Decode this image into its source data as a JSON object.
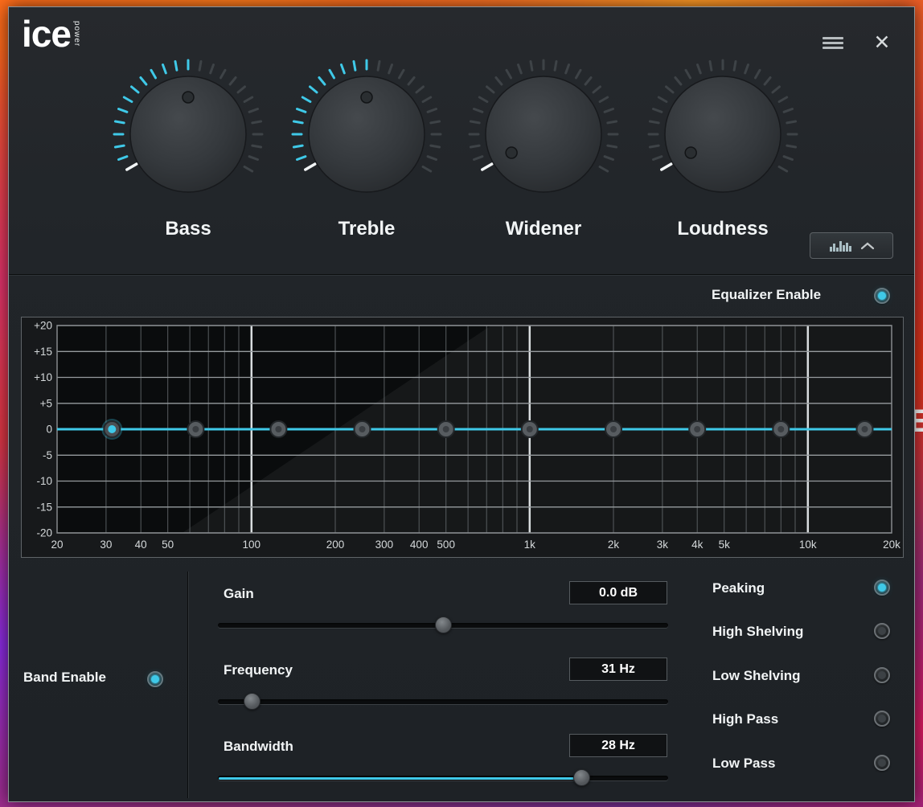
{
  "colors": {
    "accent": "#3fc9e8",
    "label_text": "#f1f4f5"
  },
  "desktop": {
    "fragment_text": "E"
  },
  "window": {
    "logo_main": "ice",
    "logo_sub": "power",
    "close_glyph": "✕"
  },
  "knobs": [
    {
      "label": "Bass",
      "value_fraction": 0.5,
      "lit": true
    },
    {
      "label": "Treble",
      "value_fraction": 0.5,
      "lit": true
    },
    {
      "label": "Widener",
      "value_fraction": 0,
      "lit": false
    },
    {
      "label": "Loudness",
      "value_fraction": 0,
      "lit": false
    }
  ],
  "equalizer": {
    "enable_label": "Equalizer Enable",
    "enabled": true
  },
  "band_controls": {
    "enable_label": "Band Enable",
    "enabled": true,
    "sliders": [
      {
        "label": "Gain",
        "value": "0.0 dB",
        "fraction": 0.5,
        "filled": false
      },
      {
        "label": "Frequency",
        "value": "31 Hz",
        "fraction": 0.06,
        "filled": false
      },
      {
        "label": "Bandwidth",
        "value": "28 Hz",
        "fraction": 0.82,
        "filled": true
      }
    ],
    "filter_types": [
      {
        "label": "Peaking",
        "selected": true
      },
      {
        "label": "High Shelving",
        "selected": false
      },
      {
        "label": "Low Shelving",
        "selected": false
      },
      {
        "label": "High Pass",
        "selected": false
      },
      {
        "label": "Low Pass",
        "selected": false
      }
    ]
  },
  "chart_data": {
    "type": "line",
    "x_scale": "log",
    "x_range_hz": [
      20,
      20000
    ],
    "y_range_db": [
      -20,
      20
    ],
    "curve_gain_db": 0,
    "grid": true,
    "y_ticks": [
      {
        "db": 20,
        "label": "+20"
      },
      {
        "db": 15,
        "label": "+15"
      },
      {
        "db": 10,
        "label": "+10"
      },
      {
        "db": 5,
        "label": "+5"
      },
      {
        "db": 0,
        "label": "0"
      },
      {
        "db": -5,
        "label": "-5"
      },
      {
        "db": -10,
        "label": "-10"
      },
      {
        "db": -15,
        "label": "-15"
      },
      {
        "db": -20,
        "label": "-20"
      }
    ],
    "x_tick_labels": [
      {
        "f": 20,
        "label": "20"
      },
      {
        "f": 30,
        "label": "30"
      },
      {
        "f": 40,
        "label": "40"
      },
      {
        "f": 50,
        "label": "50"
      },
      {
        "f": 100,
        "label": "100"
      },
      {
        "f": 200,
        "label": "200"
      },
      {
        "f": 300,
        "label": "300"
      },
      {
        "f": 400,
        "label": "400"
      },
      {
        "f": 500,
        "label": "500"
      },
      {
        "f": 1000,
        "label": "1k"
      },
      {
        "f": 2000,
        "label": "2k"
      },
      {
        "f": 3000,
        "label": "3k"
      },
      {
        "f": 4000,
        "label": "4k"
      },
      {
        "f": 5000,
        "label": "5k"
      },
      {
        "f": 10000,
        "label": "10k"
      },
      {
        "f": 20000,
        "label": "20k"
      }
    ],
    "minor_gridlines_hz": [
      30,
      40,
      50,
      60,
      70,
      80,
      90,
      200,
      300,
      400,
      500,
      600,
      700,
      800,
      900,
      2000,
      3000,
      4000,
      5000,
      6000,
      7000,
      8000,
      9000
    ],
    "major_gridlines_hz": [
      100,
      1000,
      10000
    ],
    "bands": [
      {
        "freq_hz": 31.5,
        "gain_db": 0,
        "selected": true
      },
      {
        "freq_hz": 63,
        "gain_db": 0,
        "selected": false
      },
      {
        "freq_hz": 125,
        "gain_db": 0,
        "selected": false
      },
      {
        "freq_hz": 250,
        "gain_db": 0,
        "selected": false
      },
      {
        "freq_hz": 500,
        "gain_db": 0,
        "selected": false
      },
      {
        "freq_hz": 1000,
        "gain_db": 0,
        "selected": false
      },
      {
        "freq_hz": 2000,
        "gain_db": 0,
        "selected": false
      },
      {
        "freq_hz": 4000,
        "gain_db": 0,
        "selected": false
      },
      {
        "freq_hz": 8000,
        "gain_db": 0,
        "selected": false
      },
      {
        "freq_hz": 16000,
        "gain_db": 0,
        "selected": false
      }
    ]
  }
}
